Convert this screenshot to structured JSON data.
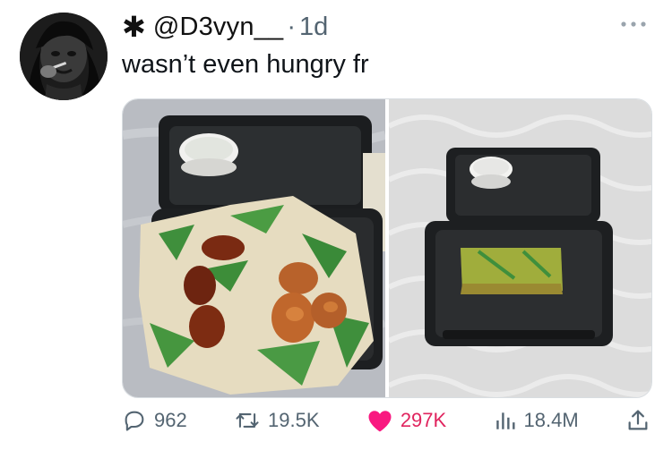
{
  "tweet": {
    "verified_mark": "✱",
    "handle": "@D3vyn__",
    "separator": "·",
    "time": "1d",
    "text": "wasn’t even hungry fr"
  },
  "icons": {
    "more": "more-icon",
    "reply": "reply-icon",
    "retweet": "retweet-icon",
    "like": "heart-icon",
    "views": "views-icon",
    "share": "share-icon"
  },
  "stats": {
    "replies": "962",
    "retweets": "19.5K",
    "likes": "297K",
    "views": "18.4M"
  },
  "colors": {
    "text": "#0f1419",
    "muted": "#536471",
    "like": "#e0245e"
  }
}
